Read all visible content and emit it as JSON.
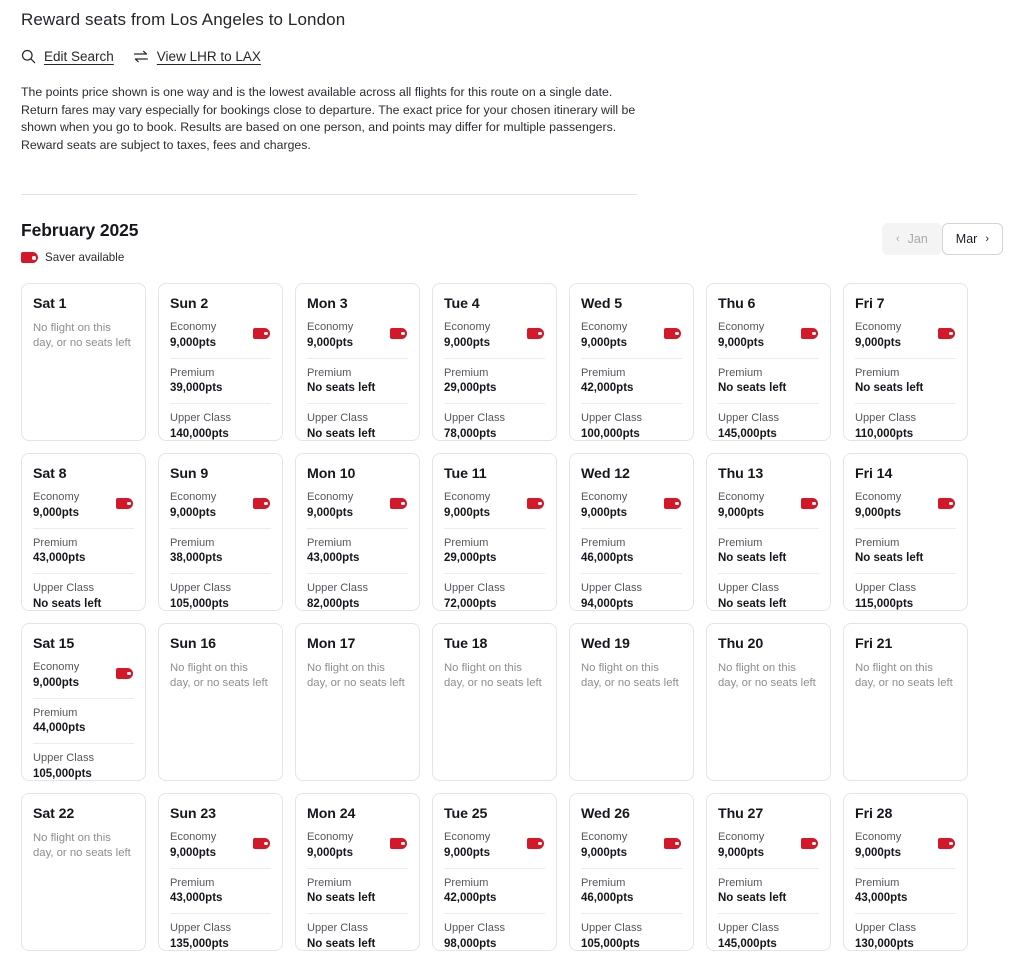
{
  "header": {
    "title": "Reward seats from Los Angeles to London",
    "actions": [
      {
        "icon": "search-icon",
        "label": "Edit Search"
      },
      {
        "icon": "swap-arrows-icon",
        "label": "View LHR to LAX"
      }
    ],
    "disclaimer": "The points price shown is one way and is the lowest available across all flights for this route on a single date. Return fares may vary especially for bookings close to departure. The exact price for your chosen itinerary will be shown when you go to book. Results are based on one person, and points may differ for multiple passengers. Reward seats are subject to taxes, fees and charges."
  },
  "month": {
    "title": "February 2025",
    "legend_label": "Saver available",
    "legend_icon": "price-tag-icon",
    "prev": {
      "label": "Jan",
      "chevron": "‹",
      "enabled": false
    },
    "next": {
      "label": "Mar",
      "chevron": "›",
      "enabled": true
    }
  },
  "colors": {
    "saver_red": "#d4182a",
    "card_border": "#e4e4e8",
    "text_primary": "#16161d",
    "text_muted": "#8c8d93"
  },
  "empty_message": "No flight on this day, or no seats left",
  "days": [
    {
      "name": "Sat 1",
      "empty": true,
      "cabins": []
    },
    {
      "name": "Sun 2",
      "empty": false,
      "cabins": [
        {
          "cabin": "Economy",
          "price": "9,000pts",
          "saver": true
        },
        {
          "cabin": "Premium",
          "price": "39,000pts",
          "saver": false
        },
        {
          "cabin": "Upper Class",
          "price": "140,000pts",
          "saver": false
        }
      ]
    },
    {
      "name": "Mon 3",
      "empty": false,
      "cabins": [
        {
          "cabin": "Economy",
          "price": "9,000pts",
          "saver": true
        },
        {
          "cabin": "Premium",
          "price": "No seats left",
          "saver": false
        },
        {
          "cabin": "Upper Class",
          "price": "No seats left",
          "saver": false
        }
      ]
    },
    {
      "name": "Tue 4",
      "empty": false,
      "cabins": [
        {
          "cabin": "Economy",
          "price": "9,000pts",
          "saver": true
        },
        {
          "cabin": "Premium",
          "price": "29,000pts",
          "saver": false
        },
        {
          "cabin": "Upper Class",
          "price": "78,000pts",
          "saver": false
        }
      ]
    },
    {
      "name": "Wed 5",
      "empty": false,
      "cabins": [
        {
          "cabin": "Economy",
          "price": "9,000pts",
          "saver": true
        },
        {
          "cabin": "Premium",
          "price": "42,000pts",
          "saver": false
        },
        {
          "cabin": "Upper Class",
          "price": "100,000pts",
          "saver": false
        }
      ]
    },
    {
      "name": "Thu 6",
      "empty": false,
      "cabins": [
        {
          "cabin": "Economy",
          "price": "9,000pts",
          "saver": true
        },
        {
          "cabin": "Premium",
          "price": "No seats left",
          "saver": false
        },
        {
          "cabin": "Upper Class",
          "price": "145,000pts",
          "saver": false
        }
      ]
    },
    {
      "name": "Fri 7",
      "empty": false,
      "cabins": [
        {
          "cabin": "Economy",
          "price": "9,000pts",
          "saver": true
        },
        {
          "cabin": "Premium",
          "price": "No seats left",
          "saver": false
        },
        {
          "cabin": "Upper Class",
          "price": "110,000pts",
          "saver": false
        }
      ]
    },
    {
      "name": "Sat 8",
      "empty": false,
      "cabins": [
        {
          "cabin": "Economy",
          "price": "9,000pts",
          "saver": true
        },
        {
          "cabin": "Premium",
          "price": "43,000pts",
          "saver": false
        },
        {
          "cabin": "Upper Class",
          "price": "No seats left",
          "saver": false
        }
      ]
    },
    {
      "name": "Sun 9",
      "empty": false,
      "cabins": [
        {
          "cabin": "Economy",
          "price": "9,000pts",
          "saver": true
        },
        {
          "cabin": "Premium",
          "price": "38,000pts",
          "saver": false
        },
        {
          "cabin": "Upper Class",
          "price": "105,000pts",
          "saver": false
        }
      ]
    },
    {
      "name": "Mon 10",
      "empty": false,
      "cabins": [
        {
          "cabin": "Economy",
          "price": "9,000pts",
          "saver": true
        },
        {
          "cabin": "Premium",
          "price": "43,000pts",
          "saver": false
        },
        {
          "cabin": "Upper Class",
          "price": "82,000pts",
          "saver": false
        }
      ]
    },
    {
      "name": "Tue 11",
      "empty": false,
      "cabins": [
        {
          "cabin": "Economy",
          "price": "9,000pts",
          "saver": true
        },
        {
          "cabin": "Premium",
          "price": "29,000pts",
          "saver": false
        },
        {
          "cabin": "Upper Class",
          "price": "72,000pts",
          "saver": false
        }
      ]
    },
    {
      "name": "Wed 12",
      "empty": false,
      "cabins": [
        {
          "cabin": "Economy",
          "price": "9,000pts",
          "saver": true
        },
        {
          "cabin": "Premium",
          "price": "46,000pts",
          "saver": false
        },
        {
          "cabin": "Upper Class",
          "price": "94,000pts",
          "saver": false
        }
      ]
    },
    {
      "name": "Thu 13",
      "empty": false,
      "cabins": [
        {
          "cabin": "Economy",
          "price": "9,000pts",
          "saver": true
        },
        {
          "cabin": "Premium",
          "price": "No seats left",
          "saver": false
        },
        {
          "cabin": "Upper Class",
          "price": "No seats left",
          "saver": false
        }
      ]
    },
    {
      "name": "Fri 14",
      "empty": false,
      "cabins": [
        {
          "cabin": "Economy",
          "price": "9,000pts",
          "saver": true
        },
        {
          "cabin": "Premium",
          "price": "No seats left",
          "saver": false
        },
        {
          "cabin": "Upper Class",
          "price": "115,000pts",
          "saver": false
        }
      ]
    },
    {
      "name": "Sat 15",
      "empty": false,
      "cabins": [
        {
          "cabin": "Economy",
          "price": "9,000pts",
          "saver": true
        },
        {
          "cabin": "Premium",
          "price": "44,000pts",
          "saver": false
        },
        {
          "cabin": "Upper Class",
          "price": "105,000pts",
          "saver": false
        }
      ]
    },
    {
      "name": "Sun 16",
      "empty": true,
      "cabins": []
    },
    {
      "name": "Mon 17",
      "empty": true,
      "cabins": []
    },
    {
      "name": "Tue 18",
      "empty": true,
      "cabins": []
    },
    {
      "name": "Wed 19",
      "empty": true,
      "cabins": []
    },
    {
      "name": "Thu 20",
      "empty": true,
      "cabins": []
    },
    {
      "name": "Fri 21",
      "empty": true,
      "cabins": []
    },
    {
      "name": "Sat 22",
      "empty": true,
      "cabins": []
    },
    {
      "name": "Sun 23",
      "empty": false,
      "cabins": [
        {
          "cabin": "Economy",
          "price": "9,000pts",
          "saver": true
        },
        {
          "cabin": "Premium",
          "price": "43,000pts",
          "saver": false
        },
        {
          "cabin": "Upper Class",
          "price": "135,000pts",
          "saver": false
        }
      ]
    },
    {
      "name": "Mon 24",
      "empty": false,
      "cabins": [
        {
          "cabin": "Economy",
          "price": "9,000pts",
          "saver": true
        },
        {
          "cabin": "Premium",
          "price": "No seats left",
          "saver": false
        },
        {
          "cabin": "Upper Class",
          "price": "No seats left",
          "saver": false
        }
      ]
    },
    {
      "name": "Tue 25",
      "empty": false,
      "cabins": [
        {
          "cabin": "Economy",
          "price": "9,000pts",
          "saver": true
        },
        {
          "cabin": "Premium",
          "price": "42,000pts",
          "saver": false
        },
        {
          "cabin": "Upper Class",
          "price": "98,000pts",
          "saver": false
        }
      ]
    },
    {
      "name": "Wed 26",
      "empty": false,
      "cabins": [
        {
          "cabin": "Economy",
          "price": "9,000pts",
          "saver": true
        },
        {
          "cabin": "Premium",
          "price": "46,000pts",
          "saver": false
        },
        {
          "cabin": "Upper Class",
          "price": "105,000pts",
          "saver": false
        }
      ]
    },
    {
      "name": "Thu 27",
      "empty": false,
      "cabins": [
        {
          "cabin": "Economy",
          "price": "9,000pts",
          "saver": true
        },
        {
          "cabin": "Premium",
          "price": "No seats left",
          "saver": false
        },
        {
          "cabin": "Upper Class",
          "price": "145,000pts",
          "saver": false
        }
      ]
    },
    {
      "name": "Fri 28",
      "empty": false,
      "cabins": [
        {
          "cabin": "Economy",
          "price": "9,000pts",
          "saver": true
        },
        {
          "cabin": "Premium",
          "price": "43,000pts",
          "saver": false
        },
        {
          "cabin": "Upper Class",
          "price": "130,000pts",
          "saver": false
        }
      ]
    }
  ]
}
